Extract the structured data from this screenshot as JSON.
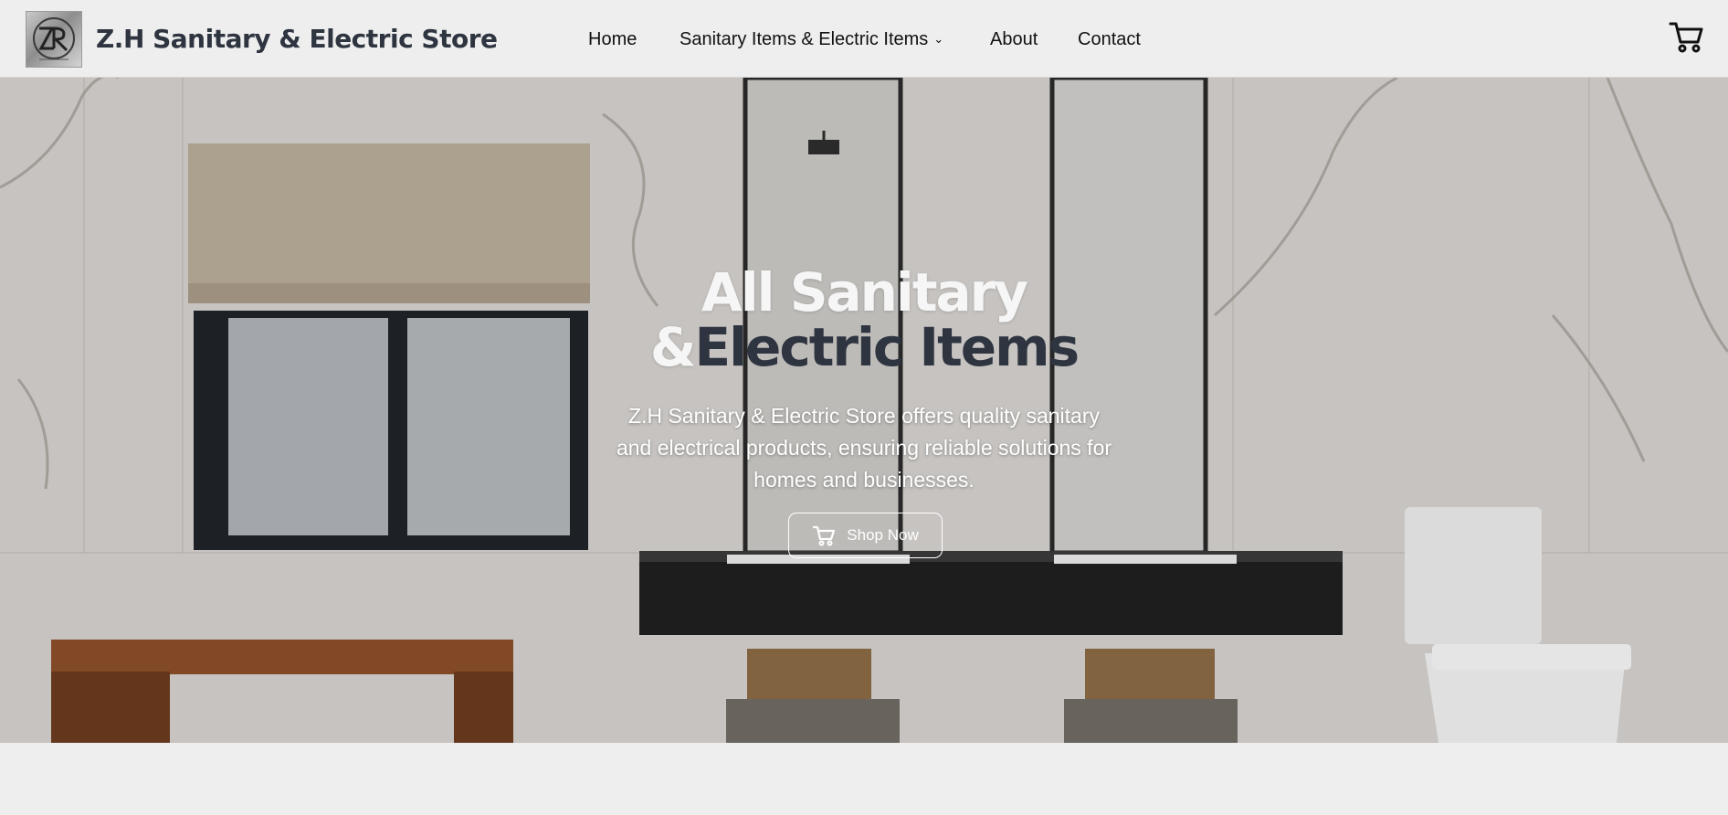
{
  "header": {
    "brand": "Z.H Sanitary & Electric Store",
    "nav": {
      "home": "Home",
      "products": "Sanitary Items & Electric Items",
      "products_caret": "⌄",
      "about": "About",
      "contact": "Contact"
    },
    "icons": {
      "logo": "zr-logo",
      "cart": "cart-icon"
    }
  },
  "hero": {
    "title_line1": "All Sanitary",
    "title_line2_prefix": "&",
    "title_line2_highlight": "Electric Items",
    "description": "Z.H Sanitary & Electric Store offers quality sanitary and electrical products, ensuring reliable solutions for homes and businesses.",
    "cta_label": "Shop Now",
    "cta_icon": "cart-icon"
  },
  "colors": {
    "navbar_bg": "#eeeeee",
    "brand_text": "#2f3540",
    "title_light": "#f6f6f6",
    "title_dark": "#2e3440"
  }
}
